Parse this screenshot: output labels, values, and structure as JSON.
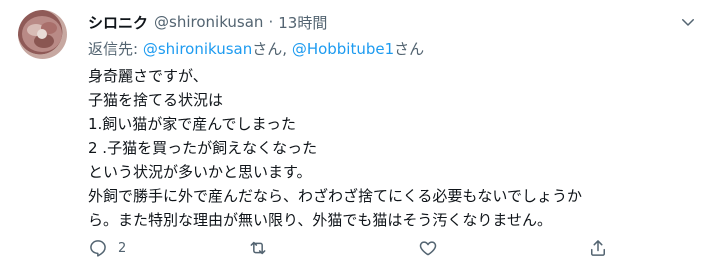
{
  "tweet": {
    "display_name": "シロニク",
    "handle": "@shironikusan",
    "separator": "·",
    "time": "13時間",
    "reply_prefix": "返信先: ",
    "reply_mention_1": "@shironikusan",
    "reply_mid": "さん, ",
    "reply_mention_2": "@Hobbitube1",
    "reply_suffix": "さん",
    "body_lines": [
      "身奇麗さですが、",
      "子猫を捨てる状況は",
      "1.飼い猫が家で産んでしまった",
      "2 .子猫を買ったが飼えなくなった",
      "という状況が多いかと思います。",
      "外飼で勝手に外で産んだなら、わざわざ捨てにくる必要もないでしょうか",
      "ら。また特別な理由が無い限り、外猫でも猫はそう汚くなりません。"
    ],
    "reply_count": "2"
  },
  "colors": {
    "text": "#0f1419",
    "secondary": "#536471",
    "link": "#1d9bf0"
  },
  "icons": {
    "caret": "chevron-down-icon",
    "reply": "reply-icon",
    "retweet": "retweet-icon",
    "like": "heart-icon",
    "share": "share-icon"
  }
}
